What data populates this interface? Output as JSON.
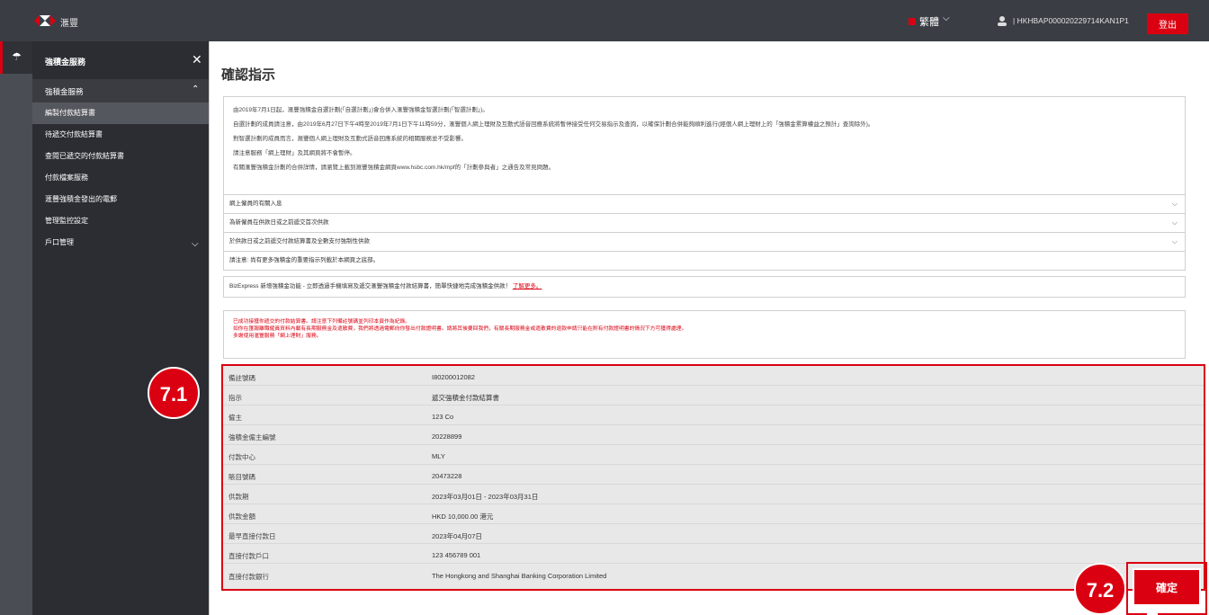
{
  "header": {
    "brand": "滙豐",
    "language": "繁體",
    "user_id": "|  HKHBAP000020229714KAN1P1",
    "logout_label": "登出"
  },
  "sidebar": {
    "title": "強積金服務",
    "section": "強積金服務",
    "items": [
      {
        "label": "編製付款結算書"
      },
      {
        "label": "待遞交付款結算書"
      },
      {
        "label": "查閱已遞交的付款結算書"
      },
      {
        "label": "付款檔案服務"
      },
      {
        "label": "滙豐強積金發出的電郵"
      },
      {
        "label": "管理監控設定"
      },
      {
        "label": "戶口管理"
      }
    ]
  },
  "main": {
    "page_title": "確認指示",
    "notice": [
      "由2019年7月1日起，滙豐強積金自選計劃(「自選計劃」)會合併入滙豐強積金智選計劃(「智選計劃」)。",
      "自選計劃的成員請注意，由2019年6月27日下午4時至2019年7月1日下午11時59分，滙豐個人網上理財及互動式語音回應系統將暫停接受任何交易指示及查詢，以確保計劃合併能夠順利進行(經個人網上理財上的「強積金累算權益之預計」查詢除外)。",
      "對智選計劃的成員而言，滙豐個人網上理財及互動式語音回應系統的相關服務並不受影響。",
      "請注意服務「網上理財」及其網頁將不會暫停。",
      "有關滙豐強積金計劃的合併詳情，請瀏覽上載到滙豐強積金網頁www.hsbc.com.hk/mpf的「計劃參與者」之通告及常見問題。"
    ],
    "accordions": [
      "網上僱員的有關入息",
      "為新僱員在供款日或之前遞交首次供款",
      "於供款日或之前遞交付款結算書及全數支付強制性供款"
    ],
    "note": "請注意: 尚有更多強積金的重要指示列載於本網頁之底部。",
    "biz_text": "BizExpress 新增強積金功能 - 立即透過手機填寫及遞交滙豐強積金付款結算書，簡單快捷地完成強積金供款！",
    "biz_link": "了解更多。",
    "ack": [
      "已成功接獲你遞交的付款結算書。請注意下列備註號碼並列印本頁作為紀錄。",
      "如你在匯報離職僱員資料內載有長期服務金及遣散費，我們將透過電郵向你發出付款證明書。請將其後要回我們，有關長期服務金或遣散費的退款申請只能在附有付款證明書的情況下方可獲得處理。",
      "多謝使用滙豐服務「網上理財」服務。"
    ],
    "details": [
      {
        "label": "備註號碼",
        "value": "I80200012082"
      },
      {
        "label": "指示",
        "value": "遞交強積金付款結算書"
      },
      {
        "label": "僱主",
        "value": "123 Co"
      },
      {
        "label": "強積金僱主編號",
        "value": "20228899"
      },
      {
        "label": "付款中心",
        "value": "MLY"
      },
      {
        "label": "賬目號碼",
        "value": "20473228"
      },
      {
        "label": "供款期",
        "value": "2023年03月01日 - 2023年03月31日"
      },
      {
        "label": "供款金額",
        "value": "HKD 10,000.00 港元"
      },
      {
        "label": "最早直接付款日",
        "value": "2023年04月07日"
      },
      {
        "label": "直接付款戶口",
        "value": "123 456789 001"
      },
      {
        "label": "直接付款銀行",
        "value": "The Hongkong and Shanghai Banking Corporation Limited"
      }
    ],
    "confirm_label": "確定"
  },
  "annotations": {
    "badge1": "7.1",
    "badge2": "7.2"
  },
  "colors": {
    "accent": "#db0011",
    "topbar": "#3b3d44",
    "sidebar": "#2b2d33"
  }
}
